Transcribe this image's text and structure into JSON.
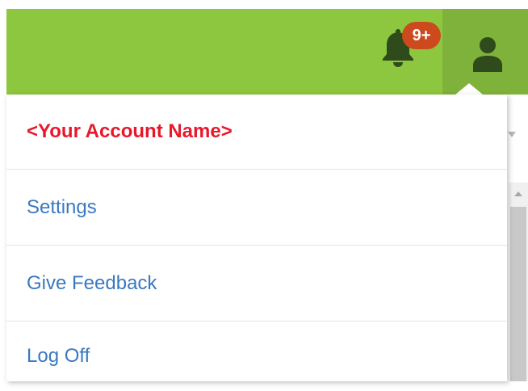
{
  "header": {
    "bar_color": "#8dc63f",
    "notifications": {
      "icon": "bell-icon",
      "badge": "9+",
      "badge_color": "#cc4a1d"
    },
    "user_button": {
      "icon": "user-icon",
      "active_color": "#7fb23a"
    }
  },
  "account_menu": {
    "account_name": "<Your Account Name>",
    "account_name_color": "#e8182b",
    "link_color": "#3a78c1",
    "items": [
      {
        "label": "Settings"
      },
      {
        "label": "Give Feedback"
      },
      {
        "label": "Log Off"
      }
    ]
  }
}
